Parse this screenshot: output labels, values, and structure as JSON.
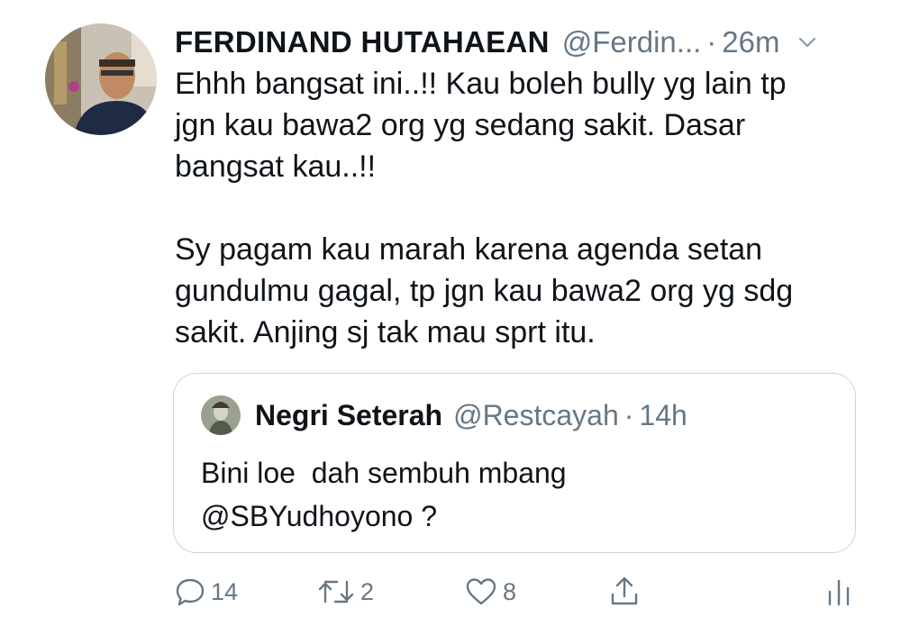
{
  "tweet": {
    "display_name": "FERDINAND HUTAHAEAN",
    "handle": "@Ferdin...",
    "separator": "·",
    "time": "26m",
    "text": "Ehhh bangsat ini..!! Kau boleh bully yg lain tp\njgn kau bawa2 org yg sedang sakit. Dasar\nbangsat kau..!!\n\nSy pagam kau marah karena agenda setan\ngundulmu gagal, tp jgn kau bawa2 org yg sdg\nsakit. Anjing sj tak mau sprt itu."
  },
  "quoted": {
    "display_name": "Negri Seterah",
    "handle": "@Restcayah",
    "separator": "·",
    "time": "14h",
    "text": "Bini loe  dah sembuh mbang\n@SBYudhoyono ?"
  },
  "actions": {
    "reply_count": "14",
    "retweet_count": "2",
    "like_count": "8"
  },
  "icons": {
    "caret": "chevron-down-icon",
    "reply": "reply-icon",
    "retweet": "retweet-icon",
    "like": "heart-icon",
    "share": "share-icon",
    "analytics": "analytics-icon"
  },
  "colors": {
    "text": "#0f1419",
    "secondary": "#657786",
    "border": "#ccd6dd"
  }
}
